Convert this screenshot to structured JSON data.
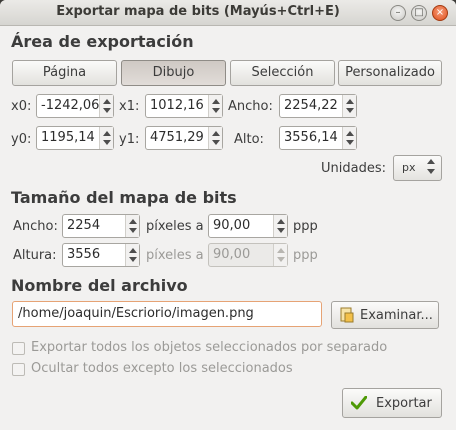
{
  "window": {
    "title": "Exportar mapa de bits (Mayús+Ctrl+E)"
  },
  "export_area": {
    "heading": "Área de exportación",
    "tabs": [
      {
        "label": "Página",
        "active": false
      },
      {
        "label": "Dibujo",
        "active": true
      },
      {
        "label": "Selección",
        "active": false
      },
      {
        "label": "Personalizado",
        "active": false
      }
    ],
    "x0_label": "x0:",
    "x0_value": "-1242,06",
    "x1_label": "x1:",
    "x1_value": "1012,16",
    "width_label": "Ancho:",
    "width_value": "2254,22",
    "y0_label": "y0:",
    "y0_value": "1195,14",
    "y1_label": "y1:",
    "y1_value": "4751,29",
    "height_label": "Alto:",
    "height_value": "3556,14",
    "units_label": "Unidades:",
    "units_value": "px"
  },
  "bitmap_size": {
    "heading": "Tamaño del mapa de bits",
    "width_label": "Ancho:",
    "width_value": "2254",
    "pixels_at_1": "píxeles a",
    "dpi_value": "90,00",
    "ppp_1": "ppp",
    "height_label": "Altura:",
    "height_value": "3556",
    "pixels_at_2": "píxeles a",
    "dpi_value_2": "90,00",
    "ppp_2": "ppp"
  },
  "filename": {
    "heading": "Nombre del archivo",
    "path": "/home/joaquin/Escriorio/imagen.png",
    "browse_label": "Examinar..."
  },
  "options": {
    "export_separately": "Exportar todos los objetos seleccionados por separado",
    "hide_except_selected": "Ocultar todos excepto los seleccionados"
  },
  "actions": {
    "export_label": "Exportar"
  }
}
